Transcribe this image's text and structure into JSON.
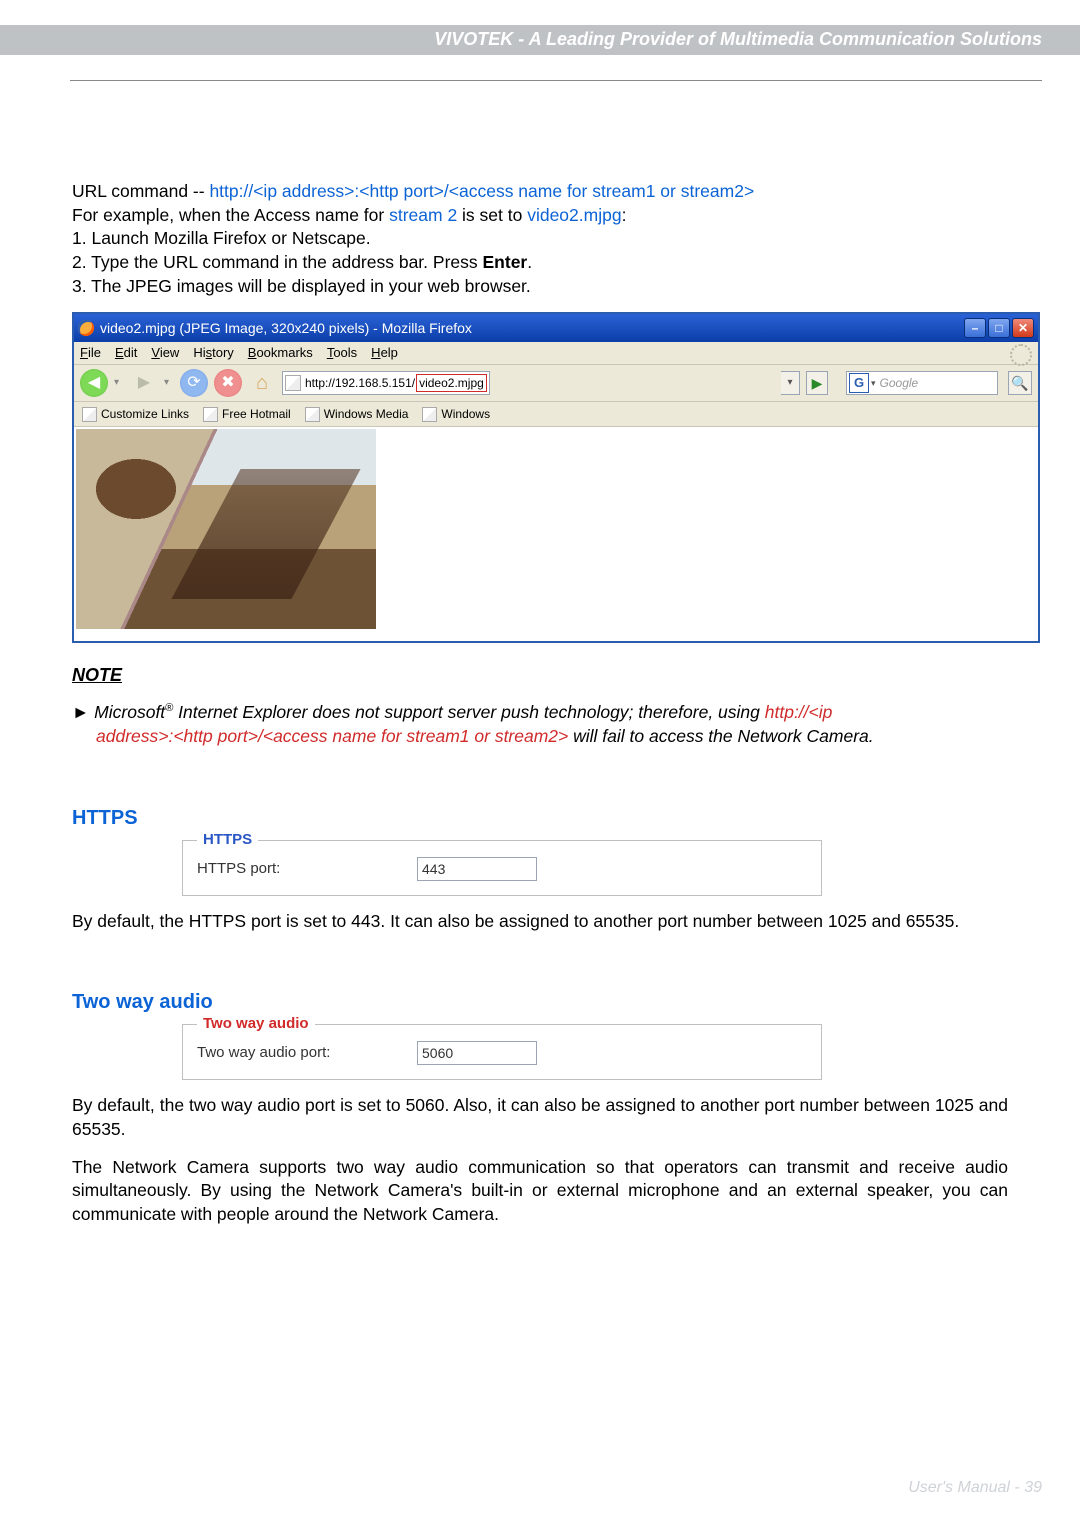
{
  "header": {
    "title": "VIVOTEK - A Leading Provider of Multimedia Communication Solutions"
  },
  "url_cmd": {
    "prefix": "URL command -- ",
    "pattern": "http://<ip address>:<http port>/<access name for stream1 or stream2>",
    "example_prefix": "For example, when the Access name for ",
    "example_stream": "stream 2",
    "example_mid": " is set to ",
    "example_value": "video2.mjpg",
    "example_suffix": ":",
    "steps": [
      "1. Launch Mozilla Firefox or Netscape.",
      "2. Type the URL command in the address bar. Press ",
      "3. The JPEG images will be displayed in your web browser."
    ],
    "enter": "Enter"
  },
  "browser": {
    "title": "video2.mjpg (JPEG Image, 320x240 pixels) - Mozilla Firefox",
    "menus": [
      "File",
      "Edit",
      "View",
      "History",
      "Bookmarks",
      "Tools",
      "Help"
    ],
    "address_base": "http://192.168.5.151/",
    "address_hl": "video2.mjpg",
    "search_placeholder": "Google",
    "bookmarks": [
      "Customize Links",
      "Free Hotmail",
      "Windows Media",
      "Windows"
    ]
  },
  "note": {
    "heading": "NOTE",
    "line1a": "► Microsoft",
    "line1sup": "®",
    "line1b": " Internet Explorer does not support server push technology; therefore, using ",
    "pattern": "http://<ip address>:<http port>/<access name for stream1 or stream2>",
    "line2": " will fail to access the Network Camera."
  },
  "https": {
    "heading": "HTTPS",
    "legend": "HTTPS",
    "label": "HTTPS port:",
    "value": "443",
    "para": "By default, the HTTPS port is set to 443. It can also be assigned to another port number between 1025 and 65535."
  },
  "twoway": {
    "heading": "Two way audio",
    "legend": "Two way audio",
    "label": "Two way audio port:",
    "value": "5060",
    "para1": "By default, the two way audio port is set to 5060. Also, it can also be assigned to another port number between 1025 and 65535.",
    "para2": "The Network Camera supports two way audio communication so that operators can transmit and receive audio simultaneously. By using the Network Camera's built-in or external microphone and an external speaker, you can communicate with people around the Network Camera."
  },
  "footer": "User's Manual - 39"
}
